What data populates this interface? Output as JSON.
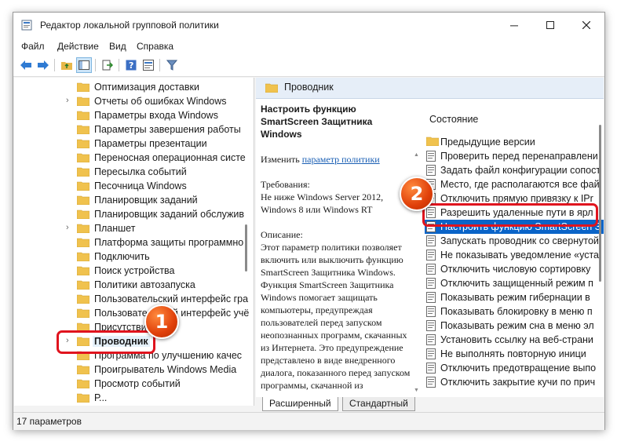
{
  "window": {
    "title": "Редактор локальной групповой политики"
  },
  "menu": [
    {
      "label": "Файл"
    },
    {
      "label": "Действие"
    },
    {
      "label": "Вид"
    },
    {
      "label": "Справка"
    }
  ],
  "toolbar": {
    "buttons": [
      "back-arrow-icon",
      "forward-arrow-icon",
      "up-folder-icon",
      "show-hide-tree-icon",
      "export-list-icon",
      "help-icon",
      "properties-icon",
      "filter-icon"
    ]
  },
  "tree": {
    "items": [
      {
        "label": "Оптимизация доставки",
        "chevron": false
      },
      {
        "label": "Отчеты об ошибках Windows",
        "chevron": true
      },
      {
        "label": "Параметры входа Windows",
        "chevron": false
      },
      {
        "label": "Параметры завершения работы",
        "chevron": false
      },
      {
        "label": "Параметры презентации",
        "chevron": false
      },
      {
        "label": "Переносная операционная систе",
        "chevron": false
      },
      {
        "label": "Пересылка событий",
        "chevron": false
      },
      {
        "label": "Песочница Windows",
        "chevron": false
      },
      {
        "label": "Планировщик заданий",
        "chevron": false
      },
      {
        "label": "Планировщик заданий обслужив",
        "chevron": false
      },
      {
        "label": "Планшет",
        "chevron": true
      },
      {
        "label": "Платформа защиты программно",
        "chevron": false
      },
      {
        "label": "Подключить",
        "chevron": false
      },
      {
        "label": "Поиск устройства",
        "chevron": false
      },
      {
        "label": "Политики автозапуска",
        "chevron": false
      },
      {
        "label": "Пользовательский интерфейс гра",
        "chevron": false
      },
      {
        "label": "Пользовательский интерфейс учё",
        "chevron": false
      },
      {
        "label": "Присутствие ... ка",
        "chevron": false
      },
      {
        "label": "Проводник",
        "chevron": true,
        "selected": true
      },
      {
        "label": "Программа по улучшению качес",
        "chevron": false
      },
      {
        "label": "Проигрыватель Windows Media",
        "chevron": false
      },
      {
        "label": "Просмотр событий",
        "chevron": false
      },
      {
        "label": "Р...",
        "chevron": false
      }
    ]
  },
  "right": {
    "header": "Проводник",
    "description": {
      "title": "Настроить функцию SmartScreen Защитника Windows",
      "edit_prefix": "Изменить",
      "edit_link": "параметр политики",
      "requirements_label": "Требования:",
      "requirements_text": "Не ниже Windows Server 2012, Windows 8 или Windows RT",
      "description_label": "Описание:",
      "description_text": "Этот параметр политики позволяет включить или выключить функцию SmartScreen Защитника Windows. Функция SmartScreen Защитника Windows помогает защищать компьютеры, предупреждая пользователей перед запуском неопознанных программ, скачанных из Интернета. Это предупреждение представлено в виде внедренного диалога, показанного перед запуском программы, скачанной из"
    },
    "list": {
      "column_header": "Состояние",
      "items": [
        {
          "label": "Предыдущие версии",
          "type": "folder"
        },
        {
          "label": "Проверить перед перенаправлени",
          "type": "setting"
        },
        {
          "label": "Задать файл конфигурации сопост",
          "type": "setting"
        },
        {
          "label": "Место, где располагаются все фай",
          "type": "setting"
        },
        {
          "label": "Отключить прямую привязку к IPr",
          "type": "setting"
        },
        {
          "label": "Разрешить удаленные пути в ярл",
          "type": "setting"
        },
        {
          "label": "Настроить функцию SmartScreen З",
          "type": "setting",
          "selected": true
        },
        {
          "label": "Запускать проводник со свернутой",
          "type": "setting"
        },
        {
          "label": "Не показывать уведомление «уста",
          "type": "setting"
        },
        {
          "label": "Отключить числовую сортировку",
          "type": "setting"
        },
        {
          "label": "Отключить защищенный режим п",
          "type": "setting"
        },
        {
          "label": "Показывать режим гибернации в",
          "type": "setting"
        },
        {
          "label": "Показывать блокировку в меню п",
          "type": "setting"
        },
        {
          "label": "Показывать режим сна в меню эл",
          "type": "setting"
        },
        {
          "label": "Установить ссылку на веб-страни",
          "type": "setting"
        },
        {
          "label": "Не выполнять повторную иници",
          "type": "setting"
        },
        {
          "label": "Отключить предотвращение выпо",
          "type": "setting"
        },
        {
          "label": "Отключить закрытие кучи по прич",
          "type": "setting"
        }
      ]
    }
  },
  "tabs": [
    {
      "label": "Расширенный",
      "active": true
    },
    {
      "label": "Стандартный",
      "active": false
    }
  ],
  "status": {
    "text": "17 параметров"
  },
  "annotations": [
    {
      "number": "1"
    },
    {
      "number": "2"
    }
  ],
  "colors": {
    "highlight": "#e0141e",
    "badge": "#e0400a",
    "selection": "#0a64c8"
  }
}
